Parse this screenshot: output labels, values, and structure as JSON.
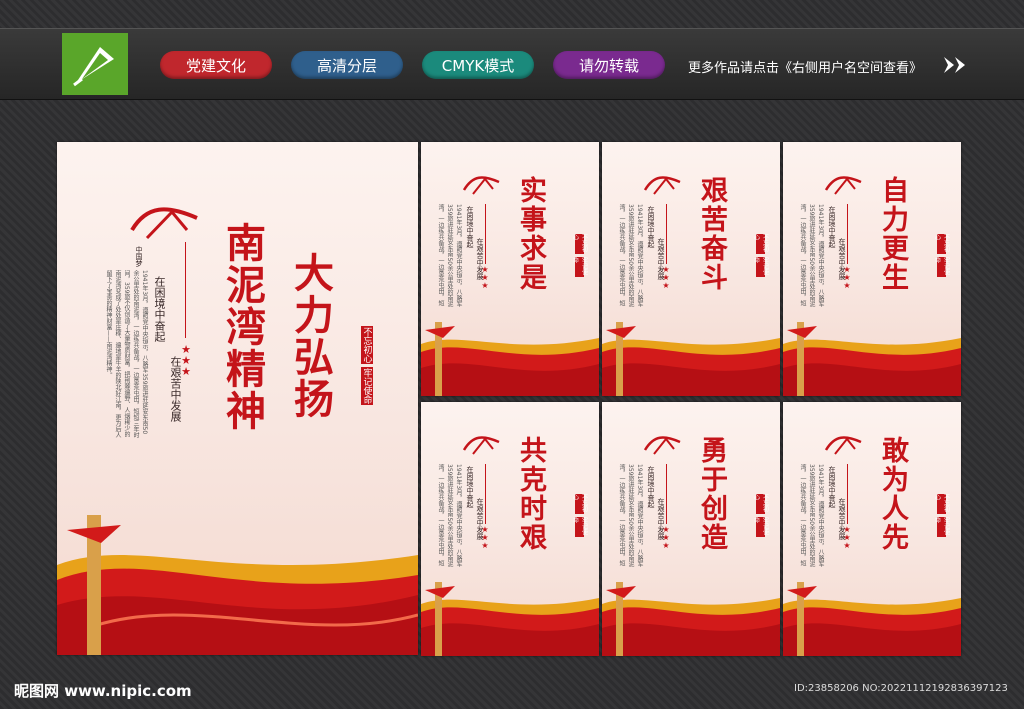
{
  "topbar": {
    "tags": [
      {
        "label": "党建文化",
        "color": "#c0272d"
      },
      {
        "label": "高清分层",
        "color": "#2f5f8c"
      },
      {
        "label": "CMYK模式",
        "color": "#1b8a7c"
      },
      {
        "label": "请勿转载",
        "color": "#7a2a8f"
      }
    ],
    "more_text": "更多作品请点击《右侧用户名空间查看》"
  },
  "main_panel": {
    "title_left": "南泥湾精神",
    "title_right": "大力弘扬",
    "subtitle_1": "在困境中奋起",
    "subtitle_2": "在艰苦中发展",
    "seal_1": "不忘初心",
    "seal_2": "牢记使命",
    "emblem_text": "中国梦",
    "body": "1941年3月，遵照党中央指示，八路军359旅进驻延安东南50余公里处的南泥湾，一边练兵备战，一边垦荒屯田，短短三年时间，359旅不仅创造了大量物质财富，把荆棘遍野、人烟稀少的南泥湾变成了处处是庄稼、遍地是牛羊的陕北好江南，更为后人留下了宝贵的精神财富——南泥湾精神。"
  },
  "small_panels": [
    {
      "title": "实事求是"
    },
    {
      "title": "艰苦奋斗"
    },
    {
      "title": "自力更生"
    },
    {
      "title": "共克时艰"
    },
    {
      "title": "勇于创造"
    },
    {
      "title": "敢为人先"
    }
  ],
  "small_common": {
    "subtitle_1": "在困境中奋起",
    "subtitle_2": "在艰苦中发展",
    "seal_1": "不忘初心",
    "seal_2": "牢记使命",
    "emblem_text": "中国梦"
  },
  "footer": {
    "site": "昵图网 www.nipic.com",
    "id": "ID:23858206 NO:20221112192836397123"
  },
  "colors": {
    "accent": "#c4141a",
    "brand_green": "#5aa62a"
  }
}
